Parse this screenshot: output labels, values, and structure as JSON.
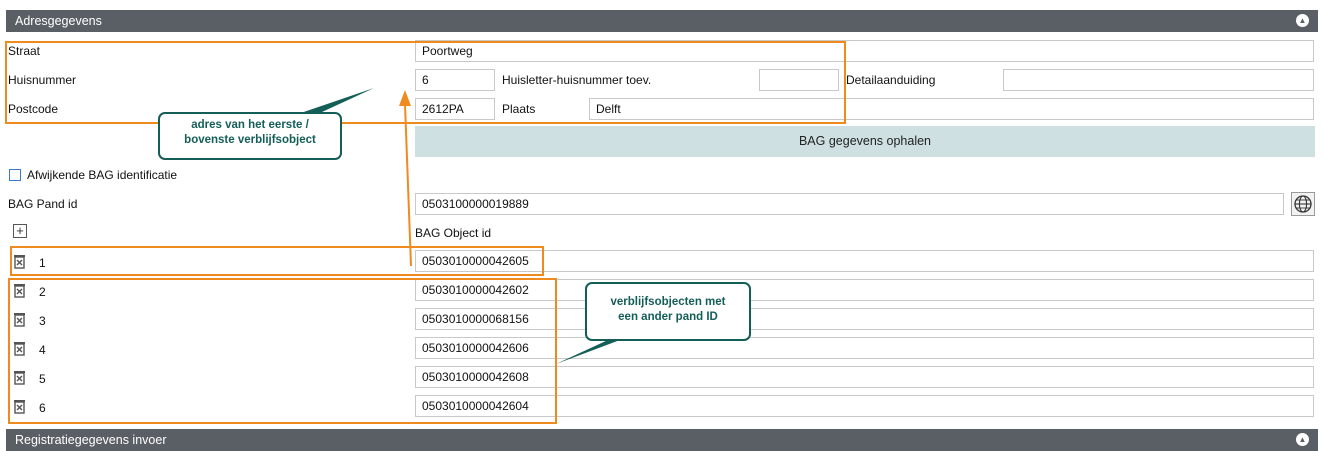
{
  "sections": {
    "address_title": "Adresgegevens",
    "registration_title": "Registratiegegevens invoer"
  },
  "labels": {
    "straat": "Straat",
    "huisnummer": "Huisnummer",
    "postcode": "Postcode",
    "huisletter": "Huisletter-huisnummer toev.",
    "detail": "Detailaanduiding",
    "plaats": "Plaats",
    "afwijkend": "Afwijkende BAG identificatie",
    "bag_pand": "BAG Pand id",
    "bag_object": "BAG Object id"
  },
  "values": {
    "straat": "Poortweg",
    "huisnummer": "6",
    "huisletter": "",
    "detail": "",
    "postcode": "2612PA",
    "plaats": "Delft",
    "bag_pand": "0503100000019889"
  },
  "buttons": {
    "bag_fetch": "BAG gegevens ophalen"
  },
  "objects": [
    {
      "index": "1",
      "id": "0503010000042605"
    },
    {
      "index": "2",
      "id": "0503010000042602"
    },
    {
      "index": "3",
      "id": "0503010000068156"
    },
    {
      "index": "4",
      "id": "0503010000042606"
    },
    {
      "index": "5",
      "id": "0503010000042608"
    },
    {
      "index": "6",
      "id": "0503010000042604"
    }
  ],
  "callouts": {
    "first": [
      "adres van het eerste /",
      "bovenste verblijfsobject"
    ],
    "other": [
      "verblijfsobjecten met",
      "een ander pand ID"
    ]
  },
  "icons": {
    "collapse": "chevron-up-icon",
    "globe": "globe-icon",
    "add": "plus-icon",
    "delete": "trash-icon"
  },
  "colors": {
    "header": "#5a5f66",
    "highlight": "#ef8a1f",
    "callout": "#145e58",
    "button": "#cfe0e3"
  }
}
